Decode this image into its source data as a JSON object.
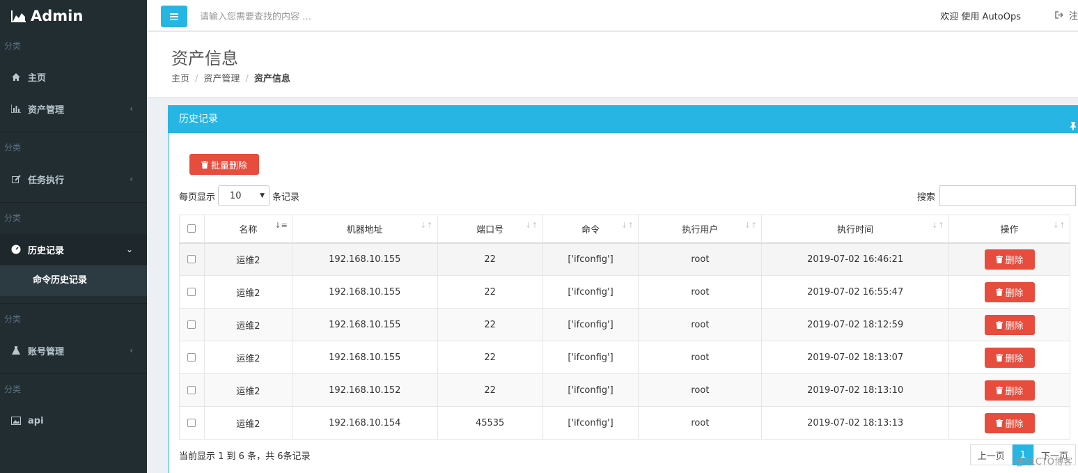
{
  "app": {
    "logo_text": "Admin"
  },
  "sidebar": {
    "sections": [
      {
        "label": "分类"
      },
      {
        "label": "分类"
      },
      {
        "label": "分类"
      },
      {
        "label": "分类"
      },
      {
        "label": "分类"
      }
    ],
    "items": [
      {
        "label": "主页",
        "icon": "home-icon"
      },
      {
        "label": "资产管理",
        "icon": "bar-chart-icon"
      },
      {
        "label": "任务执行",
        "icon": "edit-icon"
      },
      {
        "label": "历史记录",
        "icon": "dashboard-icon"
      },
      {
        "label": "账号管理",
        "icon": "flask-icon"
      },
      {
        "label": "api",
        "icon": "image-icon"
      }
    ],
    "submenu": {
      "label": "命令历史记录"
    }
  },
  "header": {
    "search_placeholder": "请输入您需要查找的内容 …",
    "welcome": "欢迎 使用 AutoOps",
    "logout": "注"
  },
  "page": {
    "title": "资产信息",
    "breadcrumb": [
      "主页",
      "资产管理",
      "资产信息"
    ]
  },
  "panel": {
    "title": "历史记录",
    "batch_delete": "批量删除",
    "per_page_prefix": "每页显示",
    "per_page_value": "10",
    "per_page_suffix": "条记录",
    "search_label": "搜索",
    "columns": [
      "名称",
      "机器地址",
      "端口号",
      "命令",
      "执行用户",
      "执行时间",
      "操作"
    ],
    "rows": [
      {
        "name": "运维2",
        "ip": "192.168.10.155",
        "port": "22",
        "cmd": "['ifconfig']",
        "user": "root",
        "time": "2019-07-02 16:46:21",
        "action": "删除"
      },
      {
        "name": "运维2",
        "ip": "192.168.10.155",
        "port": "22",
        "cmd": "['ifconfig']",
        "user": "root",
        "time": "2019-07-02 16:55:47",
        "action": "删除"
      },
      {
        "name": "运维2",
        "ip": "192.168.10.155",
        "port": "22",
        "cmd": "['ifconfig']",
        "user": "root",
        "time": "2019-07-02 18:12:59",
        "action": "删除"
      },
      {
        "name": "运维2",
        "ip": "192.168.10.155",
        "port": "22",
        "cmd": "['ifconfig']",
        "user": "root",
        "time": "2019-07-02 18:13:07",
        "action": "删除"
      },
      {
        "name": "运维2",
        "ip": "192.168.10.152",
        "port": "22",
        "cmd": "['ifconfig']",
        "user": "root",
        "time": "2019-07-02 18:13:10",
        "action": "删除"
      },
      {
        "name": "运维2",
        "ip": "192.168.10.154",
        "port": "45535",
        "cmd": "['ifconfig']",
        "user": "root",
        "time": "2019-07-02 18:13:13",
        "action": "删除"
      }
    ],
    "info": "当前显示 1 到 6 条，共 6条记录",
    "pager": {
      "prev": "上一页",
      "current": "1",
      "next": "下一页"
    }
  },
  "watermark": "@51CTO博客",
  "colors": {
    "accent": "#27b6e4",
    "danger": "#e74c3c",
    "sidebar": "#222d32"
  }
}
